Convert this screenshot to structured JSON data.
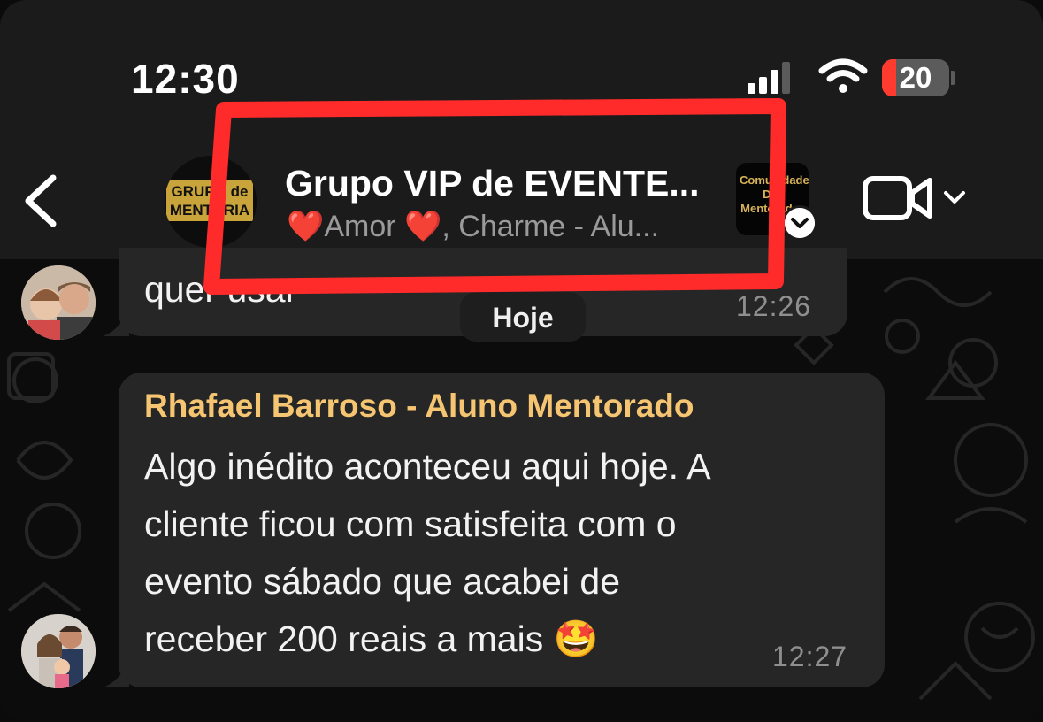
{
  "status_bar": {
    "time": "12:30",
    "battery_level": "20"
  },
  "header": {
    "group_title": "Grupo VIP de EVENTE...",
    "group_avatar_text_1": "GRUPO de",
    "group_avatar_text_2": "MENTORIA",
    "subtitle_heart": "❤️",
    "subtitle_name": "Amor",
    "subtitle_rest": ", Charme - Alu...",
    "community_text": "Comunidade DJs Mentorados"
  },
  "chat": {
    "date_separator": "Hoje",
    "messages": [
      {
        "text": "quer usar",
        "time": "12:26"
      },
      {
        "sender": "Rhafael Barroso - Aluno Mentorado",
        "lines": [
          "Algo inédito aconteceu aqui hoje. A",
          "cliente ficou com satisfeita com o",
          "evento sábado que acabei de",
          "receber 200 reais a mais 🤩"
        ],
        "time": "12:27"
      }
    ]
  },
  "colors": {
    "highlight": "#ff2a2a",
    "sender_name": "#f5c572",
    "bubble": "#262626",
    "header_bg": "#1b1b1b"
  },
  "icons": [
    "back-chevron-icon",
    "video-call-icon",
    "chevron-down-icon",
    "signal-icon",
    "wifi-icon",
    "battery-icon"
  ]
}
